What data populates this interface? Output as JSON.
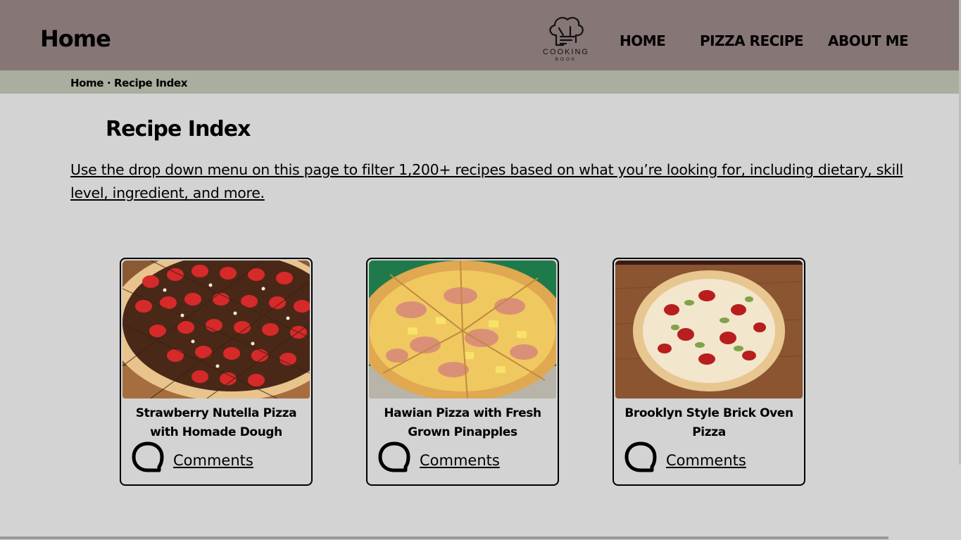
{
  "header": {
    "site_title": "Home",
    "logo_text_top": "COOKING",
    "logo_text_bottom": "BOOK",
    "nav": [
      {
        "label": "HOME"
      },
      {
        "label": "PIZZA RECIPE"
      },
      {
        "label": "ABOUT ME"
      }
    ],
    "background_color": "#877676"
  },
  "breadcrumb": {
    "home": "Home",
    "separator": "·",
    "current": "Recipe Index",
    "background_color": "#a9ae9e"
  },
  "main": {
    "title": "Recipe Index",
    "intro": "Use the drop down menu on this page to filter 1,200+ recipes based on what you’re looking for, including dietary, skill level, ingredient, and more.",
    "cards": [
      {
        "title": "Strawberry Nutella Pizza with Homade Dough",
        "comments_label": "Comments",
        "image": "strawberry-nutella-pizza-photo"
      },
      {
        "title": "Hawian Pizza with Fresh Grown Pinapples",
        "comments_label": "Comments",
        "image": "hawaiian-pizza-photo"
      },
      {
        "title": "Brooklyn Style Brick Oven Pizza",
        "comments_label": "Comments",
        "image": "brick-oven-pizza-photo"
      }
    ]
  }
}
